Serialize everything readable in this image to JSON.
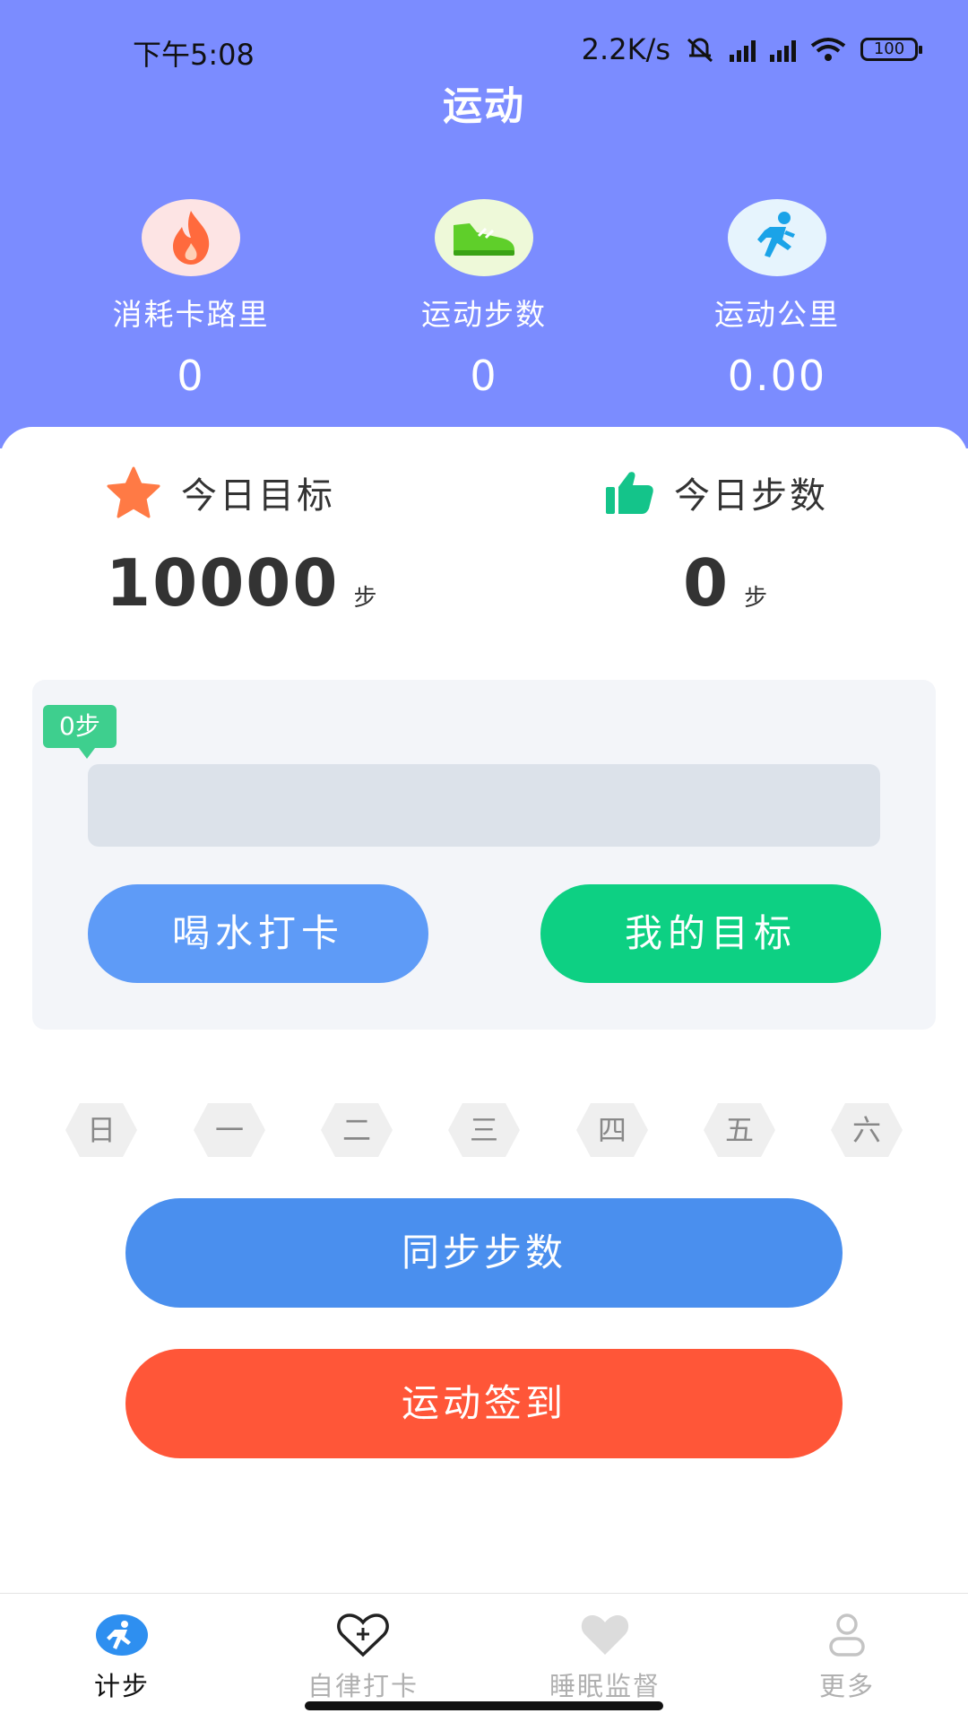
{
  "status_bar": {
    "time": "下午5:08",
    "network_speed": "2.2K/s",
    "battery": "100"
  },
  "header": {
    "title": "运动"
  },
  "stats": [
    {
      "icon": "flame-icon",
      "label": "消耗卡路里",
      "value": "0"
    },
    {
      "icon": "sneaker-icon",
      "label": "运动步数",
      "value": "0"
    },
    {
      "icon": "runner-icon",
      "label": "运动公里",
      "value": "0.00"
    }
  ],
  "goal": {
    "label": "今日目标",
    "value": "10000",
    "unit": "步"
  },
  "today": {
    "label": "今日步数",
    "value": "0",
    "unit": "步"
  },
  "progress": {
    "bubble_text": "0步",
    "fraction": 0
  },
  "actions": {
    "water_label": "喝水打卡",
    "my_goal_label": "我的目标"
  },
  "week_days": [
    "日",
    "一",
    "二",
    "三",
    "四",
    "五",
    "六"
  ],
  "buttons": {
    "sync_label": "同步步数",
    "checkin_label": "运动签到"
  },
  "tabs": [
    {
      "icon": "runner-icon",
      "label": "计步",
      "active": true
    },
    {
      "icon": "heart-plus-icon",
      "label": "自律打卡",
      "active": false
    },
    {
      "icon": "heart-icon",
      "label": "睡眠监督",
      "active": false
    },
    {
      "icon": "person-icon",
      "label": "更多",
      "active": false
    }
  ],
  "colors": {
    "header_bg": "#7b8cff",
    "water_button": "#5e9bf7",
    "goal_button": "#0dd083",
    "sync_button": "#4a8fee",
    "checkin_button": "#ff5638",
    "progress_tag": "#3ecf8e"
  }
}
